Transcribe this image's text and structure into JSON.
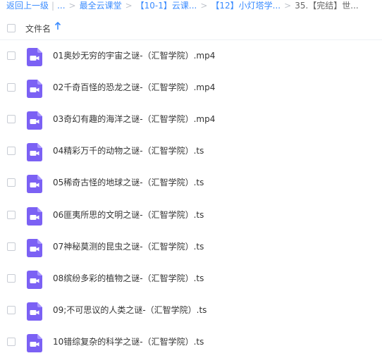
{
  "breadcrumb": {
    "back": "返回上一级",
    "ellipsis": "...",
    "items": [
      "最全云课堂",
      "【10-1】云课...",
      "【12】小灯塔学...",
      "35.【完结】世..."
    ]
  },
  "header": {
    "column_label": "文件名",
    "sort_direction": "ascending"
  },
  "colors": {
    "accent": "#3b8cff",
    "video_icon": "#7b61f4"
  },
  "files": [
    {
      "name": "01奥妙无穷的宇宙之谜-（汇智学院）.mp4",
      "icon": "video-file-icon"
    },
    {
      "name": "02千奇百怪的恐龙之谜-（汇智学院）.mp4",
      "icon": "video-file-icon"
    },
    {
      "name": "03奇幻有趣的海洋之谜-（汇智学院）.mp4",
      "icon": "video-file-icon"
    },
    {
      "name": "04精彩万千的动物之谜-（汇智学院）.ts",
      "icon": "video-file-icon"
    },
    {
      "name": "05稀奇古怪的地球之谜-（汇智学院）.ts",
      "icon": "video-file-icon"
    },
    {
      "name": "06匪夷所思的文明之谜-（汇智学院）.ts",
      "icon": "video-file-icon"
    },
    {
      "name": "07神秘莫测的昆虫之谜-（汇智学院）.ts",
      "icon": "video-file-icon"
    },
    {
      "name": "08缤纷多彩的植物之谜-（汇智学院）.ts",
      "icon": "video-file-icon"
    },
    {
      "name": "09;不可思议的人类之谜-（汇智学院）.ts",
      "icon": "video-file-icon"
    },
    {
      "name": "10错综复杂的科学之谜-（汇智学院）.ts",
      "icon": "video-file-icon"
    }
  ]
}
